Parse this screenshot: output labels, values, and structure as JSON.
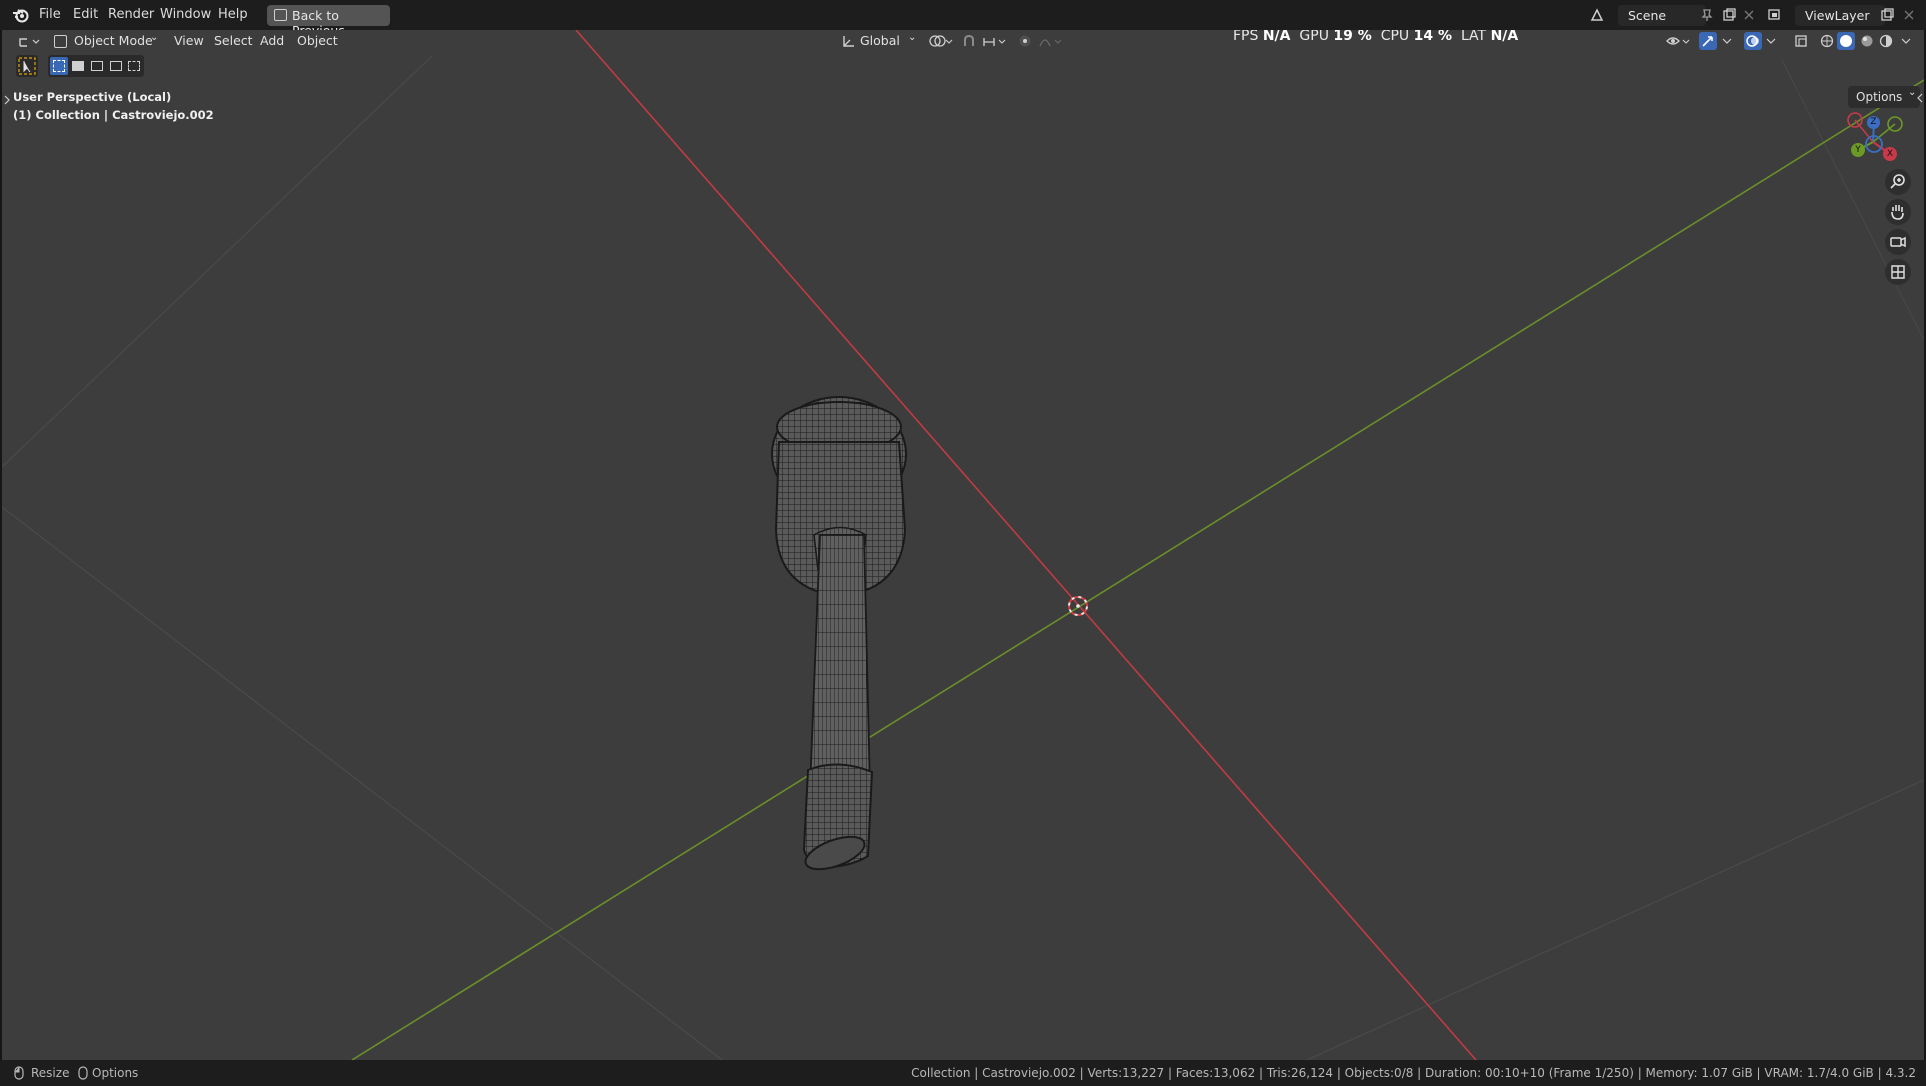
{
  "menu": {
    "items": [
      "File",
      "Edit",
      "Render",
      "Window",
      "Help"
    ],
    "back_button": "Back to Previous",
    "scene": "Scene",
    "view_layer": "ViewLayer"
  },
  "viewport_header": {
    "mode": "Object Mode",
    "menus": [
      "View",
      "Select",
      "Add",
      "Object"
    ],
    "transform_orientation": "Global",
    "options": "Options"
  },
  "performance": {
    "fps_label": "FPS",
    "fps_value": "N/A",
    "gpu_label": "GPU",
    "gpu_value": "19 %",
    "cpu_label": "CPU",
    "cpu_value": "14 %",
    "lat_label": "LAT",
    "lat_value": "N/A"
  },
  "overlay": {
    "view_name": "User Perspective (Local)",
    "collection_info": "(1) Collection | Castroviejo.002"
  },
  "gizmo": {
    "x": "X",
    "y": "Y",
    "z": "Z",
    "colors": {
      "x": "#c83a4a",
      "y": "#6c9a26",
      "z": "#3a6fc4"
    }
  },
  "status_bar": {
    "left": [
      "Resize",
      "Options"
    ],
    "stats": "Collection | Castroviejo.002 | Verts:13,227 | Faces:13,062 | Tris:26,124 | Objects:0/8 | Duration: 00:10+10 (Frame 1/250) | Memory: 1.07 GiB | VRAM: 1.7/4.0 GiB | 4.3.2"
  },
  "colors": {
    "x_axis": "#c03b44",
    "y_axis": "#6a8f2a",
    "viewport_bg": "#3d3d3d"
  }
}
